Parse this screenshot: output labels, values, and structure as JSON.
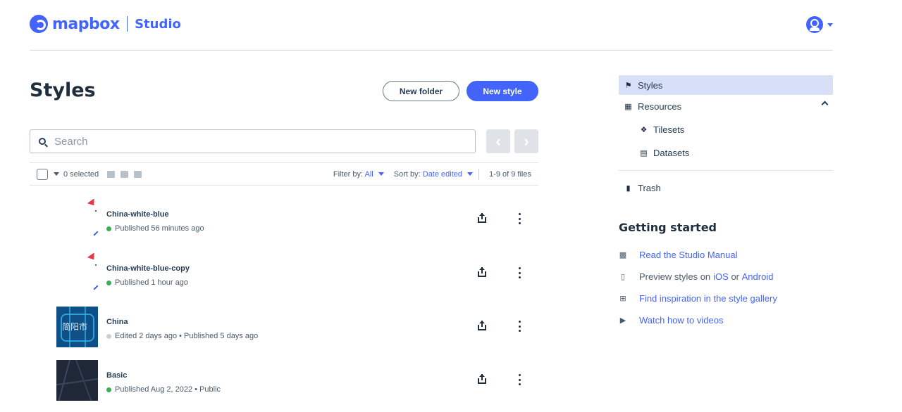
{
  "header": {
    "logo_word": "mapbox",
    "product": "Studio"
  },
  "main": {
    "title": "Styles",
    "new_folder_label": "New folder",
    "new_style_label": "New style",
    "search_placeholder": "Search",
    "pager_prev": "‹",
    "pager_next": "›",
    "toolbar": {
      "selected": "0 selected",
      "filter_label": "Filter by:",
      "filter_value": "All",
      "sort_label": "Sort by:",
      "sort_value": "Date edited",
      "count": "1-9 of 9 files"
    },
    "styles": [
      {
        "name": "China-white-blue",
        "status": "Published 56 minutes ago",
        "status_color": "#33b352"
      },
      {
        "name": "China-white-blue-copy",
        "status": "Published 1 hour ago",
        "status_color": "#33b352"
      },
      {
        "name": "China",
        "status": "Edited 2 days ago • Published 5 days ago",
        "status_color": "#c8ced4",
        "thumb_label": "简阳市"
      },
      {
        "name": "Basic",
        "status": "Published Aug 2, 2022 • Public",
        "status_color": "#33b352"
      }
    ]
  },
  "sidebar": {
    "items": [
      {
        "label": "Styles",
        "icon": "map-icon",
        "active": true
      },
      {
        "label": "Resources",
        "icon": "grid-icon"
      },
      {
        "label": "Tilesets",
        "icon": "layers-icon"
      },
      {
        "label": "Datasets",
        "icon": "database-icon"
      },
      {
        "label": "Trash",
        "icon": "trash-icon"
      }
    ],
    "getting_started": {
      "title": "Getting started",
      "manual": "Read the Studio Manual",
      "preview_prefix": "Preview styles on ",
      "ios": "iOS",
      "or": " or ",
      "android": "Android",
      "gallery": "Find inspiration in the style gallery",
      "videos": "Watch how to videos"
    }
  },
  "colors": {
    "accent": "#4264fb",
    "published": "#33b352",
    "edited": "#c8ced4"
  }
}
